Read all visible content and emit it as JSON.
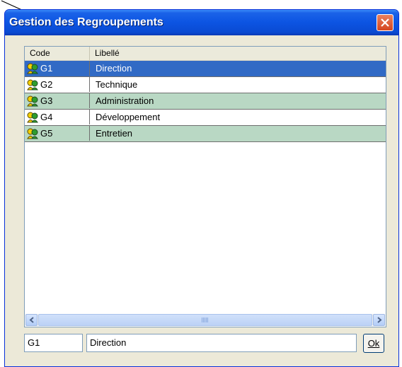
{
  "window": {
    "title": "Gestion des Regroupements",
    "title_color": "#0c54e2",
    "close_color": "#d5451f"
  },
  "list": {
    "columns": {
      "code": "Code",
      "libelle": "Libellé"
    },
    "rows": [
      {
        "code": "G1",
        "libelle": "Direction",
        "state": "selected"
      },
      {
        "code": "G2",
        "libelle": "Technique",
        "state": "white"
      },
      {
        "code": "G3",
        "libelle": "Administration",
        "state": "green"
      },
      {
        "code": "G4",
        "libelle": "Développement",
        "state": "white"
      },
      {
        "code": "G5",
        "libelle": "Entretien",
        "state": "green"
      }
    ],
    "row_icon": "group-icon",
    "selected_color": "#316ac5",
    "alt_row_color": "#b9d8c4"
  },
  "form": {
    "code_value": "G1",
    "libelle_value": "Direction",
    "ok_label": "Ok"
  }
}
